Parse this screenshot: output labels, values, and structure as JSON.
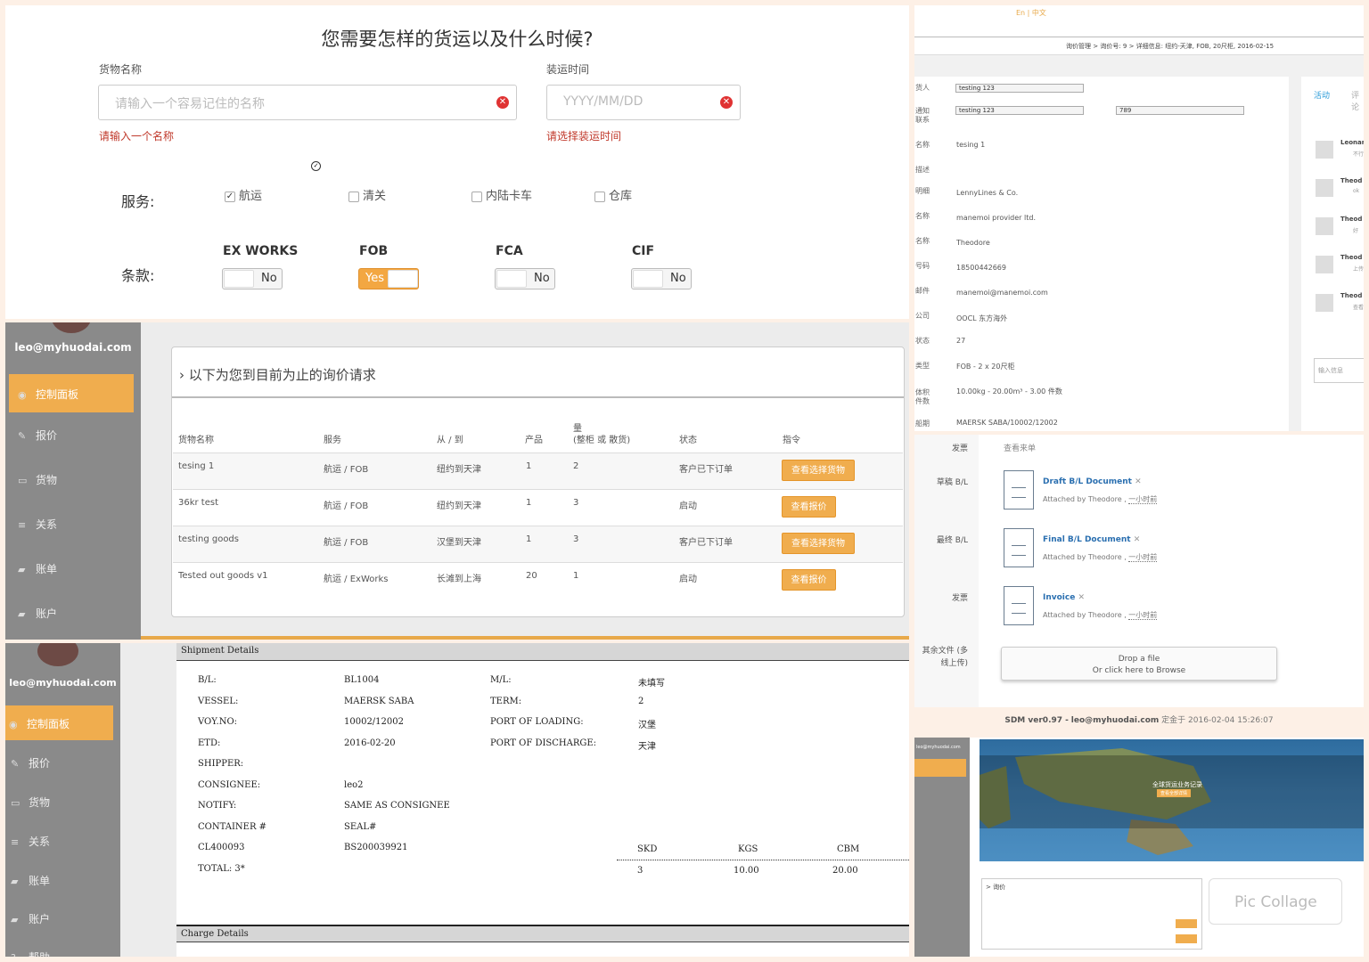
{
  "form": {
    "title": "您需要怎样的货运以及什么时候?",
    "cargo_label": "货物名称",
    "cargo_placeholder": "请输入一个容易记住的名称",
    "cargo_error": "请输入一个名称",
    "date_label": "装运时间",
    "date_placeholder": "YYYY/MM/DD",
    "date_error": "请选择装运时间",
    "services_label": "服务:",
    "services": [
      {
        "label": "航运",
        "checked": true
      },
      {
        "label": "清关",
        "checked": false
      },
      {
        "label": "内陆卡车",
        "checked": false
      },
      {
        "label": "仓库",
        "checked": false
      }
    ],
    "terms_label": "条款:",
    "terms": [
      {
        "name": "EX WORKS",
        "toggle": "No",
        "on": false
      },
      {
        "name": "FOB",
        "toggle": "Yes",
        "on": true
      },
      {
        "name": "FCA",
        "toggle": "No",
        "on": false
      },
      {
        "name": "CIF",
        "toggle": "No",
        "on": false
      }
    ]
  },
  "dashboard": {
    "email": "leo@myhuodai.com",
    "nav": [
      "控制面板",
      "报价",
      "货物",
      "关系",
      "账单",
      "账户"
    ],
    "nav_extra": "帮助",
    "card_title": "以下为您到目前为止的询价请求",
    "columns": [
      "货物名称",
      "服务",
      "从 / 到",
      "产品",
      "量",
      "(整柜 或 散货)",
      "状态",
      "指令"
    ],
    "rows": [
      {
        "name": "tesing 1",
        "service": "航运 / FOB",
        "route": "纽约到天津",
        "products": "1",
        "qty": "2",
        "status": "客户已下订单",
        "action": "查看选择货物"
      },
      {
        "name": "36kr test",
        "service": "航运 / FOB",
        "route": "纽约到天津",
        "products": "1",
        "qty": "3",
        "status": "启动",
        "action": "查看报价"
      },
      {
        "name": "testing goods",
        "service": "航运 / FOB",
        "route": "汉堡到天津",
        "products": "1",
        "qty": "3",
        "status": "客户已下订单",
        "action": "查看选择货物"
      },
      {
        "name": "Tested out goods v1",
        "service": "航运 / ExWorks",
        "route": "长滩到上海",
        "products": "20",
        "qty": "1",
        "status": "启动",
        "action": "查看报价"
      }
    ]
  },
  "shipment": {
    "header": "Shipment Details",
    "footer": "Charge Details",
    "fields_left": [
      [
        "B/L:",
        "BL1004"
      ],
      [
        "VESSEL:",
        "MAERSK SABA"
      ],
      [
        "VOY.NO:",
        "10002/12002"
      ],
      [
        "ETD:",
        "2016-02-20"
      ],
      [
        "SHIPPER:",
        ""
      ],
      [
        "CONSIGNEE:",
        "leo2"
      ],
      [
        "NOTIFY:",
        "SAME AS CONSIGNEE"
      ],
      [
        "CONTAINER #",
        "SEAL#"
      ],
      [
        "CL400093",
        "BS200039921"
      ],
      [
        "TOTAL: 3*",
        ""
      ]
    ],
    "fields_right": [
      [
        "M/L:",
        "未填写"
      ],
      [
        "TERM:",
        "2"
      ],
      [
        "PORT OF LOADING:",
        "汉堡"
      ],
      [
        "PORT OF DISCHARGE:",
        "天津"
      ]
    ],
    "totals_head": [
      "SKD",
      "KGS",
      "CBM"
    ],
    "totals_vals": [
      "3",
      "10.00",
      "20.00"
    ]
  },
  "details": {
    "lang": "En | 中文",
    "breadcrumb": "询价管理 > 询价号: 9 > 详细信息: 纽约-天津, FOB, 20尺柜, 2016-02-15",
    "labels": [
      "货人",
      "通知 联系",
      "名称",
      "描述",
      "明细",
      "名称",
      "名称",
      "号码",
      "邮件",
      "公司",
      "状态",
      "类型",
      "体积 件数",
      "船期"
    ],
    "input1": "testing 123",
    "input2": "testing 123",
    "input3": "789",
    "values": [
      "tesing 1",
      "LennyLines & Co.",
      "manemoi provider ltd.",
      "Theodore",
      "18500442669",
      "manemoi@manemoi.com",
      "OOCL 东方海外",
      "27",
      "FOB - 2 x 20尺柜",
      "10.00kg - 20.00m³ - 3.00 件数",
      "MAERSK SABA/10002/12002"
    ],
    "side_tabs": [
      "活动",
      "评论"
    ],
    "comments": [
      "Leonar",
      "Theod",
      "Theod",
      "Theod",
      "Theod"
    ],
    "comment_subs": [
      "不行",
      "ok",
      "好",
      "上传",
      "查看",
      "上传"
    ],
    "comment_placeholder": "输入信息"
  },
  "files": {
    "top_label": "发票",
    "top_link": "查看来单",
    "items": [
      {
        "label": "草稿 B/L",
        "name": "Draft B/L Document",
        "by": "Attached by Theodore ,",
        "when": "一小时前"
      },
      {
        "label": "最终 B/L",
        "name": "Final B/L Document",
        "by": "Attached by Theodore ,",
        "when": "一小时前"
      },
      {
        "label": "发票",
        "name": "Invoice",
        "by": "Attached by Theodore ,",
        "when": "一小时前"
      }
    ],
    "other_label": "其余文件 (多线上传)",
    "drop_line1": "Drop a file",
    "drop_line2": "Or click here to Browse",
    "footer_app": "SDM ver0.97 -",
    "footer_user": "leo@myhuodai.com",
    "footer_rest": "定金于 2016-02-04 15:26:07"
  },
  "mini": {
    "email": "leo@myhuodai.com",
    "map_title": "全球货运业务记录",
    "map_button": "查看全部详情",
    "table_title": "> 询价",
    "watermark": "Pic Collage"
  }
}
